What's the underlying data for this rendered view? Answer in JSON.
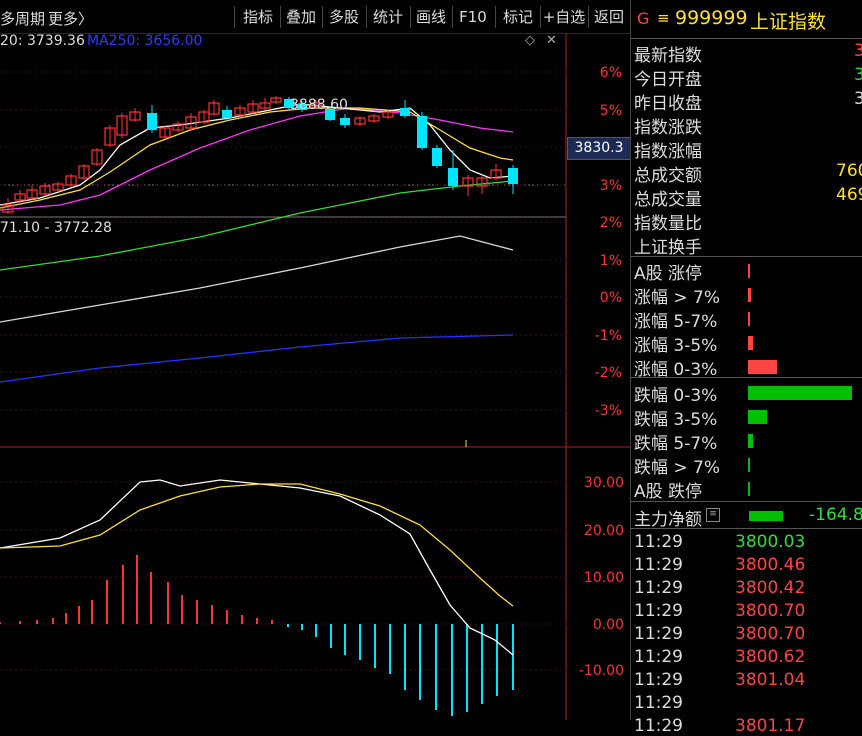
{
  "toolbar": {
    "period_label": "多周期",
    "more_label": "更多〉",
    "buttons": [
      "指标",
      "叠加",
      "多股",
      "统计",
      "画线",
      "F10",
      "标记",
      "+自选",
      "返回"
    ]
  },
  "main_chart": {
    "ma_labels": {
      "ma120": "20: 3739.36",
      "ma250": "MA250: 3656.00"
    },
    "high_label": "3888.60",
    "range_label": "71.10 - 3772.28",
    "current_price": "3830.3",
    "pct_ticks": [
      "6%",
      "5%",
      "4%",
      "3%",
      "2%",
      "1%",
      "0%",
      "-1%",
      "-2%",
      "-3%"
    ],
    "colors": {
      "up": "#ff3333",
      "down": "#00e5ff",
      "ma5": "#ffffff",
      "ma10": "#ffe033",
      "ma20": "#ff33ff",
      "ma60": "#33dd33",
      "ma120": "#dddddd",
      "ma250": "#2233ff"
    }
  },
  "macd": {
    "ticks": [
      "30.00",
      "20.00",
      "10.00",
      "0.00",
      "-10.00"
    ]
  },
  "right": {
    "title_icon": "G",
    "menu_icon": "≡",
    "code": "999999",
    "name": "上证指数",
    "rows": [
      {
        "label": "最新指数",
        "value": "3"
      },
      {
        "label": "今日开盘",
        "value": "3"
      },
      {
        "label": "昨日收盘",
        "value": "3"
      },
      {
        "label": "指数涨跌",
        "value": ""
      },
      {
        "label": "指数涨幅",
        "value": ""
      },
      {
        "label": "总成交额",
        "value": "760"
      },
      {
        "label": "总成交量",
        "value": "469"
      },
      {
        "label": "指数量比",
        "value": ""
      },
      {
        "label": "上证换手",
        "value": ""
      }
    ],
    "breadth_up": [
      {
        "label": "A股 涨停",
        "pct": 0.02
      },
      {
        "label": "涨幅 > 7%",
        "pct": 0.03
      },
      {
        "label": "涨幅 5-7%",
        "pct": 0.02
      },
      {
        "label": "涨幅 3-5%",
        "pct": 0.05
      },
      {
        "label": "涨幅 0-3%",
        "pct": 0.28
      }
    ],
    "breadth_down": [
      {
        "label": "跌幅 0-3%",
        "pct": 1.0
      },
      {
        "label": "跌幅 3-5%",
        "pct": 0.18
      },
      {
        "label": "跌幅 5-7%",
        "pct": 0.05
      },
      {
        "label": "跌幅 > 7%",
        "pct": 0.02
      },
      {
        "label": "A股 跌停",
        "pct": 0.02
      }
    ],
    "net_flow_label": "主力净额",
    "net_flow_value": "-164.8",
    "ticks": [
      {
        "time": "11:29",
        "price": "3800.03",
        "color": "#33dd33"
      },
      {
        "time": "11:29",
        "price": "3800.46",
        "color": "#ff4444"
      },
      {
        "time": "11:29",
        "price": "3800.42",
        "color": "#ff4444"
      },
      {
        "time": "11:29",
        "price": "3800.70",
        "color": "#ff4444"
      },
      {
        "time": "11:29",
        "price": "3800.70",
        "color": "#ff4444"
      },
      {
        "time": "11:29",
        "price": "3800.62",
        "color": "#ff4444"
      },
      {
        "time": "11:29",
        "price": "3801.04",
        "color": "#ff4444"
      },
      {
        "time": "11:29",
        "price": "",
        "color": "#ff4444"
      },
      {
        "time": "11:29",
        "price": "3801.17",
        "color": "#ff4444"
      }
    ]
  }
}
